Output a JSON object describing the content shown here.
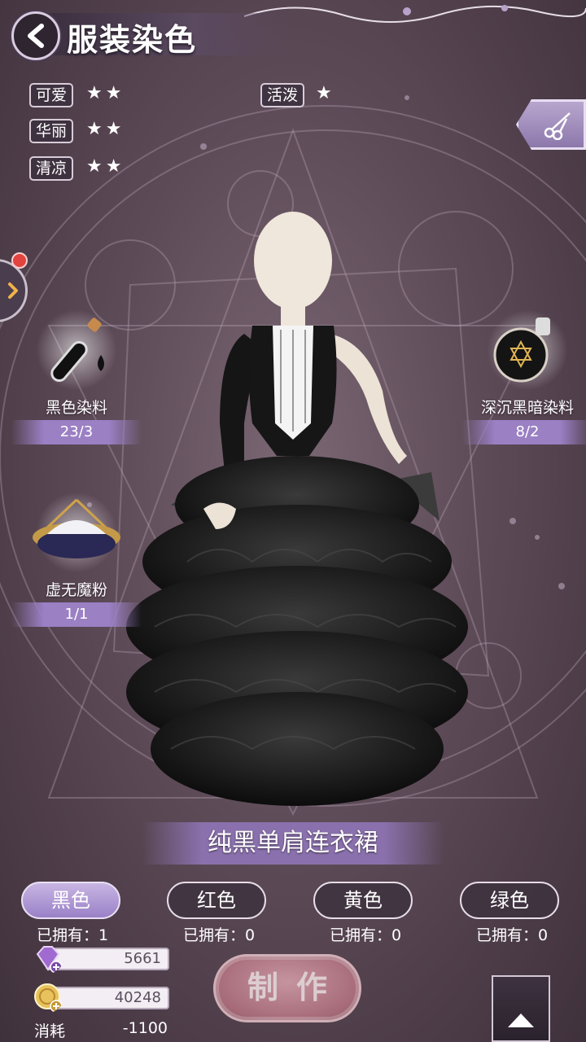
{
  "header": {
    "title": "服装染色"
  },
  "stats": [
    {
      "label": "可爱",
      "stars": "★★"
    },
    {
      "label": "华丽",
      "stars": "★★"
    },
    {
      "label": "清凉",
      "stars": "★★"
    },
    {
      "label": "活泼",
      "stars": "★"
    }
  ],
  "materials": [
    {
      "name": "黑色染料",
      "count": "23/3",
      "icon": "ink-vial-icon"
    },
    {
      "name": "深沉黑暗染料",
      "count": "8/2",
      "icon": "dark-potion-icon"
    },
    {
      "name": "虚无魔粉",
      "count": "1/1",
      "icon": "magic-powder-icon"
    }
  ],
  "dress_name": "纯黑单肩连衣裙",
  "colors": [
    {
      "label": "黑色",
      "owned": "已拥有：1",
      "active": true
    },
    {
      "label": "红色",
      "owned": "已拥有：0",
      "active": false
    },
    {
      "label": "黄色",
      "owned": "已拥有：0",
      "active": false
    },
    {
      "label": "绿色",
      "owned": "已拥有：0",
      "active": false
    }
  ],
  "currency": {
    "diamonds": "5661",
    "gold": "40248"
  },
  "cost": {
    "label": "消耗",
    "value": "-1100"
  },
  "make_button": "制作",
  "theme": {
    "accent": "#9b80c4",
    "make_button": "#b77482",
    "background": "#5e4b58"
  }
}
